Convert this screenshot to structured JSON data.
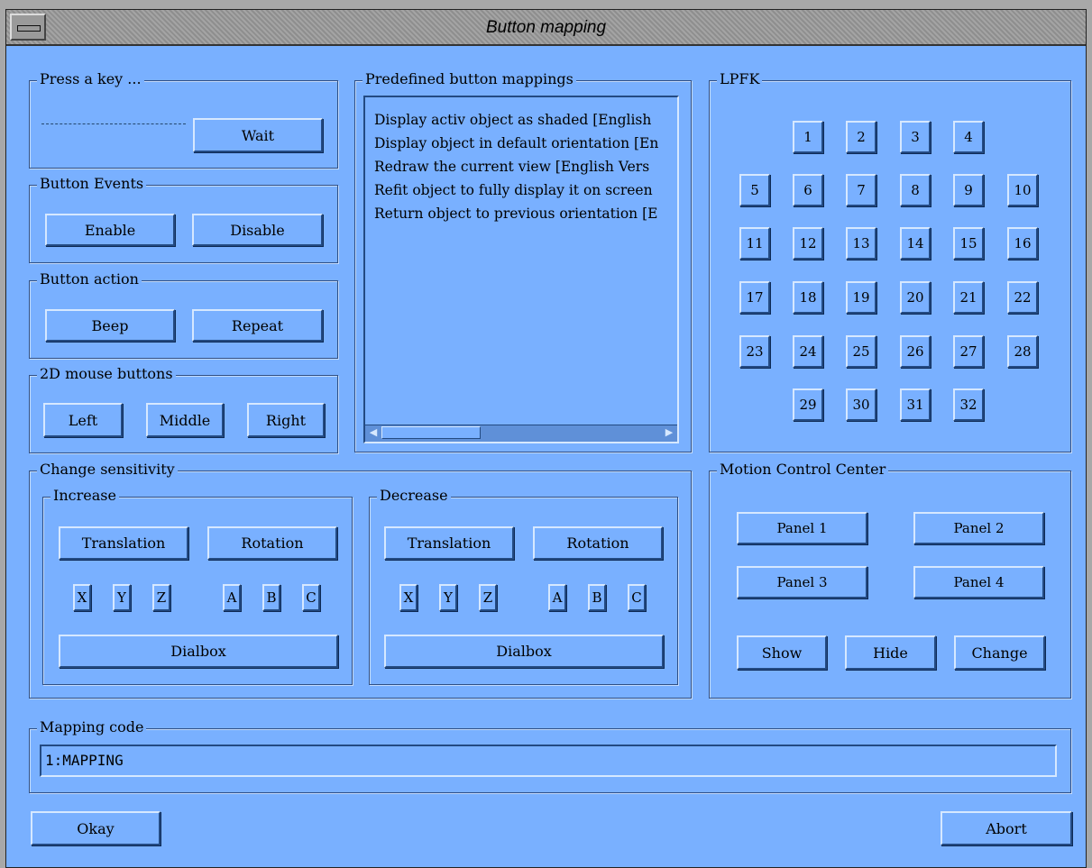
{
  "window": {
    "title": "Button mapping",
    "menu_icon": "window-menu-icon"
  },
  "press_key": {
    "label": "Press a key ...",
    "placeholder_dashes": "",
    "wait": "Wait"
  },
  "button_events": {
    "label": "Button Events",
    "enable": "Enable",
    "disable": "Disable"
  },
  "button_action": {
    "label": "Button action",
    "beep": "Beep",
    "repeat": "Repeat"
  },
  "mouse_buttons": {
    "label": "2D mouse buttons",
    "left": "Left",
    "middle": "Middle",
    "right": "Right"
  },
  "predefined": {
    "label": "Predefined button mappings",
    "items": [
      "Display activ object as shaded [English",
      "Display object in default orientation [En",
      "Redraw the current view [English Vers",
      "Refit object to fully display it on screen",
      "Return object to previous orientation [E"
    ]
  },
  "lpfk": {
    "label": "LPFK",
    "keys": [
      "1",
      "2",
      "3",
      "4",
      "5",
      "6",
      "7",
      "8",
      "9",
      "10",
      "11",
      "12",
      "13",
      "14",
      "15",
      "16",
      "17",
      "18",
      "19",
      "20",
      "21",
      "22",
      "23",
      "24",
      "25",
      "26",
      "27",
      "28",
      "29",
      "30",
      "31",
      "32"
    ]
  },
  "sensitivity": {
    "label": "Change sensitivity",
    "increase": {
      "label": "Increase",
      "translation": "Translation",
      "rotation": "Rotation",
      "x": "X",
      "y": "Y",
      "z": "Z",
      "a": "A",
      "b": "B",
      "c": "C",
      "dialbox": "Dialbox"
    },
    "decrease": {
      "label": "Decrease",
      "translation": "Translation",
      "rotation": "Rotation",
      "x": "X",
      "y": "Y",
      "z": "Z",
      "a": "A",
      "b": "B",
      "c": "C",
      "dialbox": "Dialbox"
    }
  },
  "motion": {
    "label": "Motion Control Center",
    "panel1": "Panel 1",
    "panel2": "Panel 2",
    "panel3": "Panel 3",
    "panel4": "Panel 4",
    "show": "Show",
    "hide": "Hide",
    "change": "Change"
  },
  "mapping_code": {
    "label": "Mapping code",
    "value": "1:MAPPING"
  },
  "footer": {
    "okay": "Okay",
    "abort": "Abort"
  },
  "colors": {
    "background": "#79b0ff",
    "titlebar": "#9a9a9a"
  }
}
